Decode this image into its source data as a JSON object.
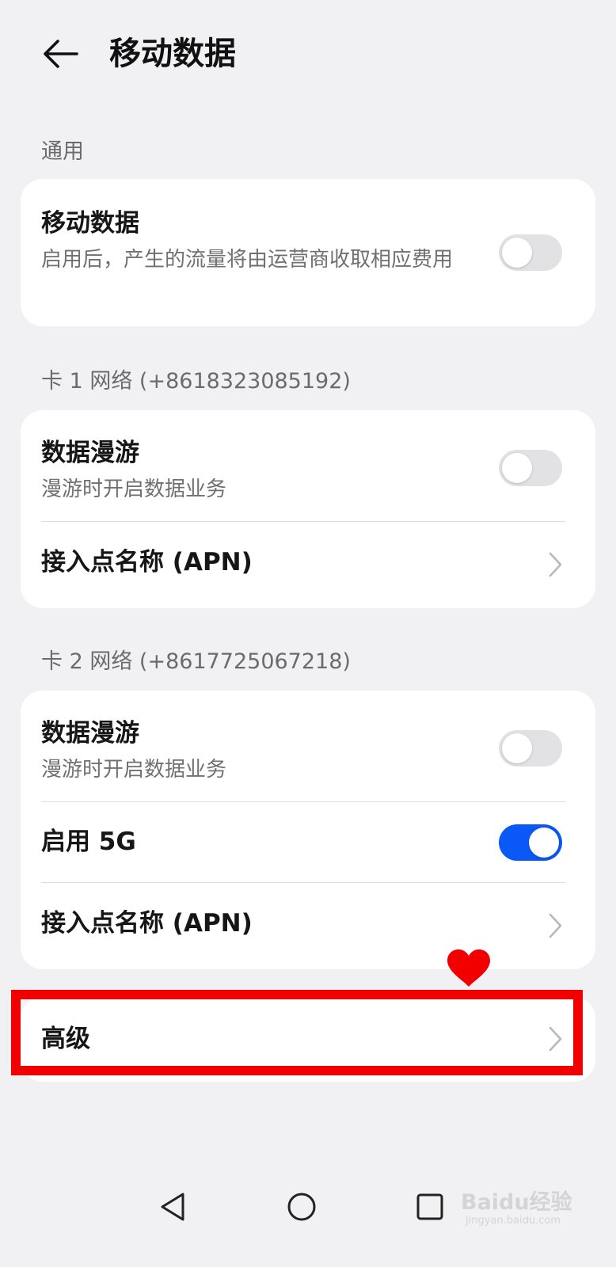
{
  "header": {
    "back_label": "←",
    "title": "移动数据"
  },
  "general": {
    "section_label": "通用",
    "mobile_data": {
      "title": "移动数据",
      "subtitle": "启用后，产生的流量将由运营商收取相应费用",
      "enabled": false
    }
  },
  "sim1": {
    "section_label": "卡 1 网络 (+8618323085192)",
    "data_roaming": {
      "title": "数据漫游",
      "subtitle": "漫游时开启数据业务",
      "enabled": false
    },
    "apn": {
      "title": "接入点名称 (APN)"
    }
  },
  "sim2": {
    "section_label": "卡 2 网络 (+8617725067218)",
    "data_roaming": {
      "title": "数据漫游",
      "subtitle": "漫游时开启数据业务",
      "enabled": false
    },
    "enable_5g": {
      "title": "启用 5G",
      "enabled": true
    },
    "apn": {
      "title": "接入点名称 (APN)"
    }
  },
  "advanced": {
    "title": "高级"
  },
  "annotation": {
    "box_color": "#f20000",
    "heart_color": "#f20000"
  },
  "watermark": {
    "main": "Baidu经验",
    "sub": "jingyan.baidu.com"
  },
  "colors": {
    "background": "#f1f1f3",
    "toggle_on": "#0a59f7",
    "toggle_off": "#e2e2e4"
  }
}
